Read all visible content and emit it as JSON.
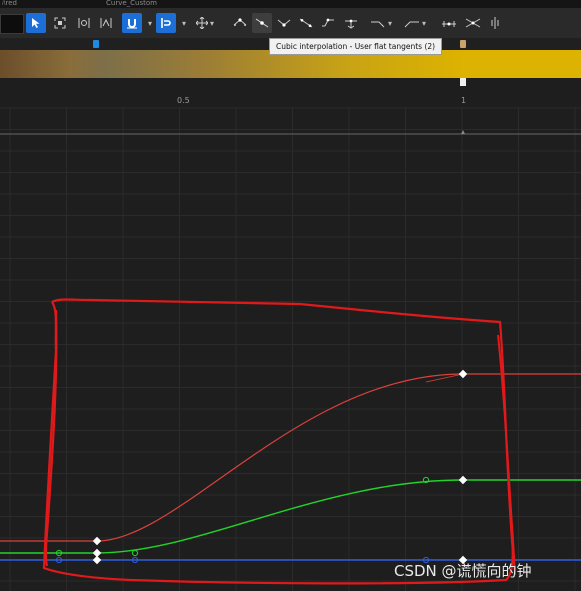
{
  "tabs": [
    "ﾊred",
    "Curve_Custom"
  ],
  "toolbar": {
    "buttons": [
      {
        "name": "select-tool",
        "icon": "cursor-icon",
        "active": true
      },
      {
        "name": "frame-button",
        "icon": "frame-icon",
        "active": false
      },
      {
        "name": "normalize-button",
        "icon": "normalize-icon",
        "active": false
      },
      {
        "name": "scale-view-button",
        "icon": "scale-icon",
        "active": false
      },
      {
        "name": "snap-value-button",
        "icon": "magnet-icon",
        "active": true
      },
      {
        "name": "snap-time-button",
        "icon": "time-snap-icon",
        "active": true
      },
      {
        "name": "transform-button",
        "icon": "move-icon",
        "active": false
      },
      {
        "name": "auto-tangent-button",
        "icon": "auto-tangent-icon",
        "active": false
      },
      {
        "name": "user-tangent-button",
        "icon": "user-tangent-icon",
        "active": true
      },
      {
        "name": "break-tangent-button",
        "icon": "break-tangent-icon",
        "active": false
      },
      {
        "name": "linear-button",
        "icon": "linear-icon",
        "active": false
      },
      {
        "name": "constant-button",
        "icon": "constant-icon",
        "active": false
      },
      {
        "name": "flatten-button",
        "icon": "flatten-icon",
        "active": false
      },
      {
        "name": "pre-infinity-button",
        "icon": "pre-infinity-icon",
        "active": false
      },
      {
        "name": "post-infinity-button",
        "icon": "post-infinity-icon",
        "active": false
      },
      {
        "name": "normalize-tangents-button",
        "icon": "normalize-tangents-icon",
        "active": false
      },
      {
        "name": "straighten-button",
        "icon": "straighten-icon",
        "active": false
      },
      {
        "name": "filter-button",
        "icon": "filter-icon",
        "active": false
      }
    ]
  },
  "tooltip": "Cubic interpolation - User flat tangents (2)",
  "ruler": {
    "labels": [
      "0.5",
      "1"
    ]
  },
  "curves": {
    "red": {
      "color": "#d9423a",
      "keys": [
        [
          0,
          0.05
        ],
        [
          1,
          0.46
        ]
      ]
    },
    "green": {
      "color": "#22d32a",
      "keys": [
        [
          0,
          0.03
        ],
        [
          1,
          0.22
        ]
      ]
    },
    "blue": {
      "color": "#2f5de0",
      "keys": [
        [
          0,
          0.0
        ],
        [
          1,
          0.0
        ]
      ]
    }
  },
  "watermark": "CSDN @谎慌向的钟"
}
